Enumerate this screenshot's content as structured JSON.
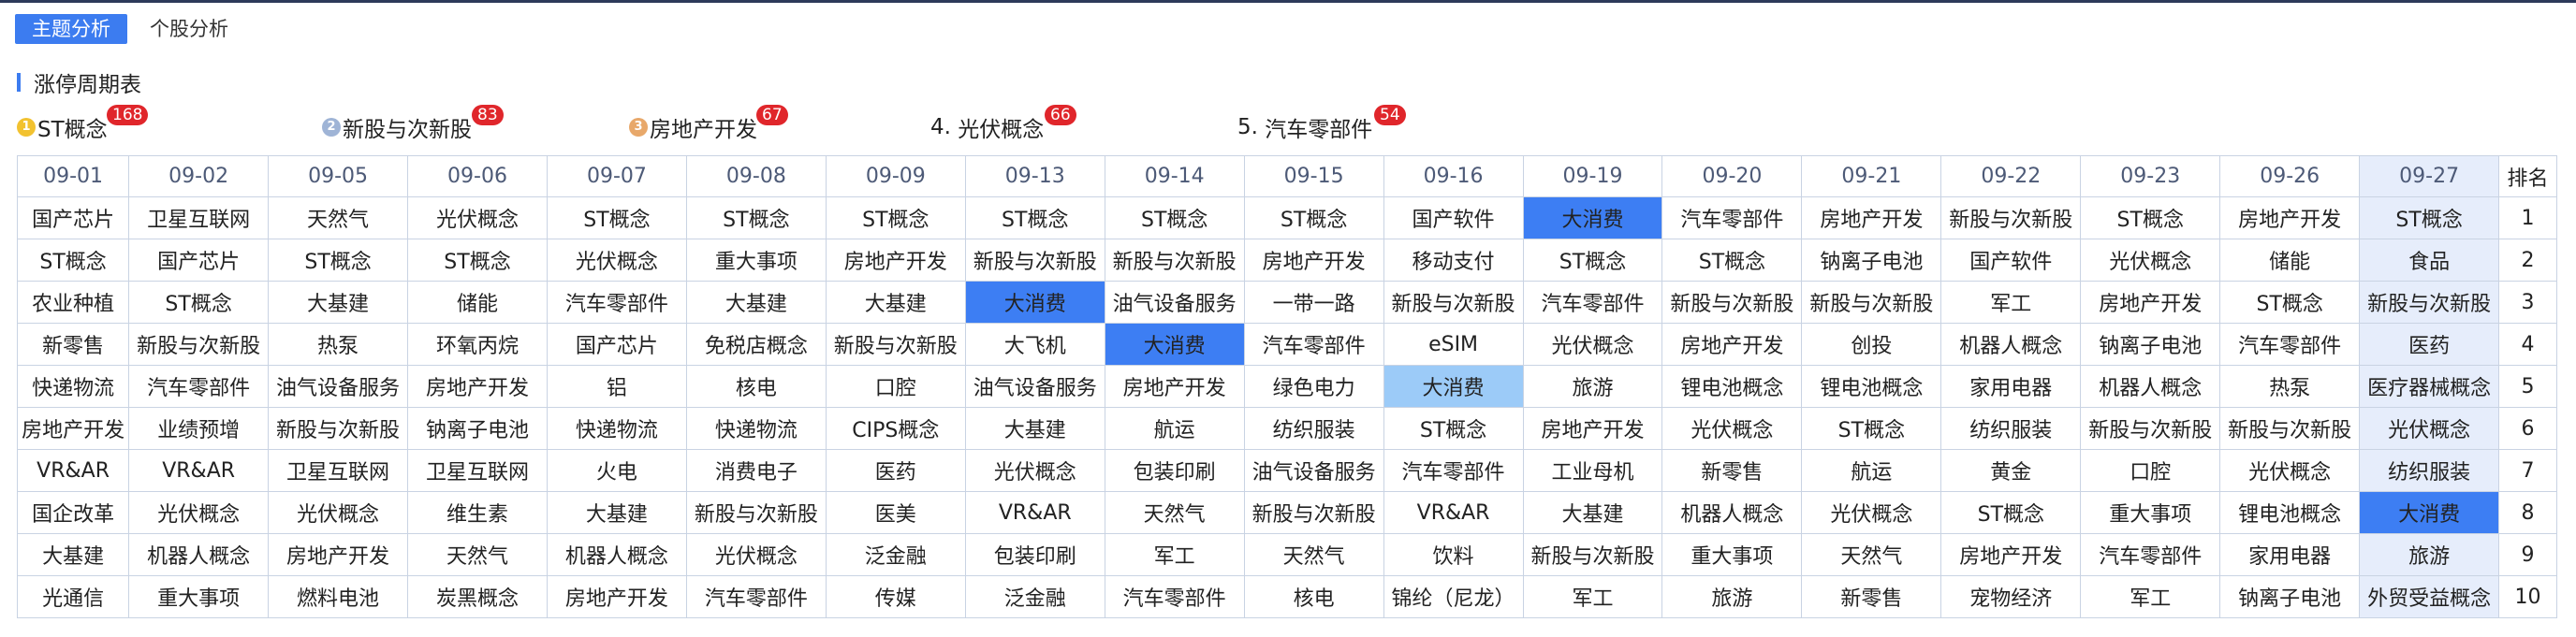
{
  "tabs": [
    {
      "label": "主题分析",
      "active": true
    },
    {
      "label": "个股分析",
      "active": false
    }
  ],
  "section_title": "涨停周期表",
  "top_themes": [
    {
      "prefix": "",
      "name": "ST概念",
      "count": "168",
      "medal": "gold"
    },
    {
      "prefix": "",
      "name": "新股与次新股",
      "count": "83",
      "medal": "silver"
    },
    {
      "prefix": "",
      "name": "房地产开发",
      "count": "67",
      "medal": "bronze"
    },
    {
      "prefix": "4. ",
      "name": "光伏概念",
      "count": "66",
      "medal": ""
    },
    {
      "prefix": "5. ",
      "name": "汽车零部件",
      "count": "54",
      "medal": ""
    }
  ],
  "table": {
    "dates": [
      "09-01",
      "09-02",
      "09-05",
      "09-06",
      "09-07",
      "09-08",
      "09-09",
      "09-13",
      "09-14",
      "09-15",
      "09-16",
      "09-19",
      "09-20",
      "09-21",
      "09-22",
      "09-23",
      "09-26",
      "09-27"
    ],
    "rank_header": "排名",
    "rows": [
      {
        "rank": "1",
        "cells": [
          "国产芯片",
          "卫星互联网",
          "天然气",
          "光伏概念",
          "ST概念",
          "ST概念",
          "ST概念",
          "ST概念",
          "ST概念",
          "ST概念",
          "国产软件",
          "大消费",
          "汽车零部件",
          "房地产开发",
          "新股与次新股",
          "ST概念",
          "房地产开发",
          "ST概念"
        ]
      },
      {
        "rank": "2",
        "cells": [
          "ST概念",
          "国产芯片",
          "ST概念",
          "ST概念",
          "光伏概念",
          "重大事项",
          "房地产开发",
          "新股与次新股",
          "新股与次新股",
          "房地产开发",
          "移动支付",
          "ST概念",
          "ST概念",
          "钠离子电池",
          "国产软件",
          "光伏概念",
          "储能",
          "食品"
        ]
      },
      {
        "rank": "3",
        "cells": [
          "农业种植",
          "ST概念",
          "大基建",
          "储能",
          "汽车零部件",
          "大基建",
          "大基建",
          "大消费",
          "油气设备服务",
          "一带一路",
          "新股与次新股",
          "汽车零部件",
          "新股与次新股",
          "新股与次新股",
          "军工",
          "房地产开发",
          "ST概念",
          "新股与次新股"
        ]
      },
      {
        "rank": "4",
        "cells": [
          "新零售",
          "新股与次新股",
          "热泵",
          "环氧丙烷",
          "国产芯片",
          "免税店概念",
          "新股与次新股",
          "大飞机",
          "大消费",
          "汽车零部件",
          "eSIM",
          "光伏概念",
          "房地产开发",
          "创投",
          "机器人概念",
          "钠离子电池",
          "汽车零部件",
          "医药"
        ]
      },
      {
        "rank": "5",
        "cells": [
          "快递物流",
          "汽车零部件",
          "油气设备服务",
          "房地产开发",
          "铝",
          "核电",
          "口腔",
          "油气设备服务",
          "房地产开发",
          "绿色电力",
          "大消费",
          "旅游",
          "锂电池概念",
          "锂电池概念",
          "家用电器",
          "机器人概念",
          "热泵",
          "医疗器械概念"
        ]
      },
      {
        "rank": "6",
        "cells": [
          "房地产开发",
          "业绩预增",
          "新股与次新股",
          "钠离子电池",
          "快递物流",
          "快递物流",
          "CIPS概念",
          "大基建",
          "航运",
          "纺织服装",
          "ST概念",
          "房地产开发",
          "光伏概念",
          "ST概念",
          "纺织服装",
          "新股与次新股",
          "新股与次新股",
          "光伏概念"
        ]
      },
      {
        "rank": "7",
        "cells": [
          "VR&AR",
          "VR&AR",
          "卫星互联网",
          "卫星互联网",
          "火电",
          "消费电子",
          "医药",
          "光伏概念",
          "包装印刷",
          "油气设备服务",
          "汽车零部件",
          "工业母机",
          "新零售",
          "航运",
          "黄金",
          "口腔",
          "光伏概念",
          "纺织服装"
        ]
      },
      {
        "rank": "8",
        "cells": [
          "国企改革",
          "光伏概念",
          "光伏概念",
          "维生素",
          "大基建",
          "新股与次新股",
          "医美",
          "VR&AR",
          "天然气",
          "新股与次新股",
          "VR&AR",
          "大基建",
          "机器人概念",
          "光伏概念",
          "ST概念",
          "重大事项",
          "锂电池概念",
          "大消费"
        ]
      },
      {
        "rank": "9",
        "cells": [
          "大基建",
          "机器人概念",
          "房地产开发",
          "天然气",
          "机器人概念",
          "光伏概念",
          "泛金融",
          "包装印刷",
          "军工",
          "天然气",
          "饮料",
          "新股与次新股",
          "重大事项",
          "天然气",
          "房地产开发",
          "汽车零部件",
          "家用电器",
          "旅游"
        ]
      },
      {
        "rank": "10",
        "cells": [
          "光通信",
          "重大事项",
          "燃料电池",
          "炭黑概念",
          "房地产开发",
          "汽车零部件",
          "传媒",
          "泛金融",
          "汽车零部件",
          "核电",
          "锦纶（尼龙）",
          "军工",
          "旅游",
          "新零售",
          "宠物经济",
          "军工",
          "钠离子电池",
          "外贸受益概念"
        ]
      }
    ],
    "highlight_theme": "大消费",
    "highlight_colors": {
      "primary": "#3d7ef3",
      "secondary": "#6faaf5",
      "light": "#9ccbf8",
      "current_column": "#e6edfb"
    }
  }
}
